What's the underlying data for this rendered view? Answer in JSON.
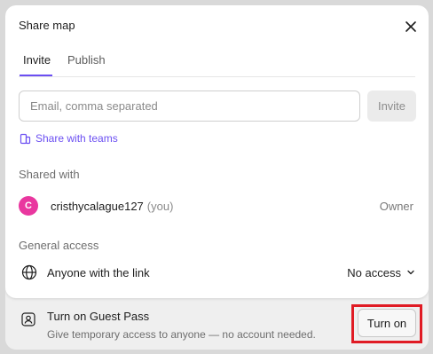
{
  "dialog": {
    "title": "Share map",
    "close_icon": "close-icon"
  },
  "tabs": [
    {
      "label": "Invite",
      "active": true
    },
    {
      "label": "Publish",
      "active": false
    }
  ],
  "invite": {
    "email_placeholder": "Email, comma separated",
    "email_value": "",
    "invite_label": "Invite",
    "share_teams_label": "Share with teams",
    "share_teams_icon": "teams-icon"
  },
  "shared_with": {
    "label": "Shared with",
    "users": [
      {
        "initial": "C",
        "name": "cristhycalague127",
        "suffix": "(you)",
        "role": "Owner",
        "avatar_color": "#e9379f"
      }
    ]
  },
  "general_access": {
    "label": "General access",
    "icon": "globe-icon",
    "text": "Anyone with the link",
    "selected": "No access"
  },
  "guest_pass": {
    "icon": "guest-pass-icon",
    "title": "Turn on Guest Pass",
    "subtitle": "Give temporary access to anyone — no account needed.",
    "button_label": "Turn on"
  },
  "colors": {
    "accent": "#6b4ff2",
    "highlight": "#e01b24",
    "avatar": "#e9379f"
  }
}
